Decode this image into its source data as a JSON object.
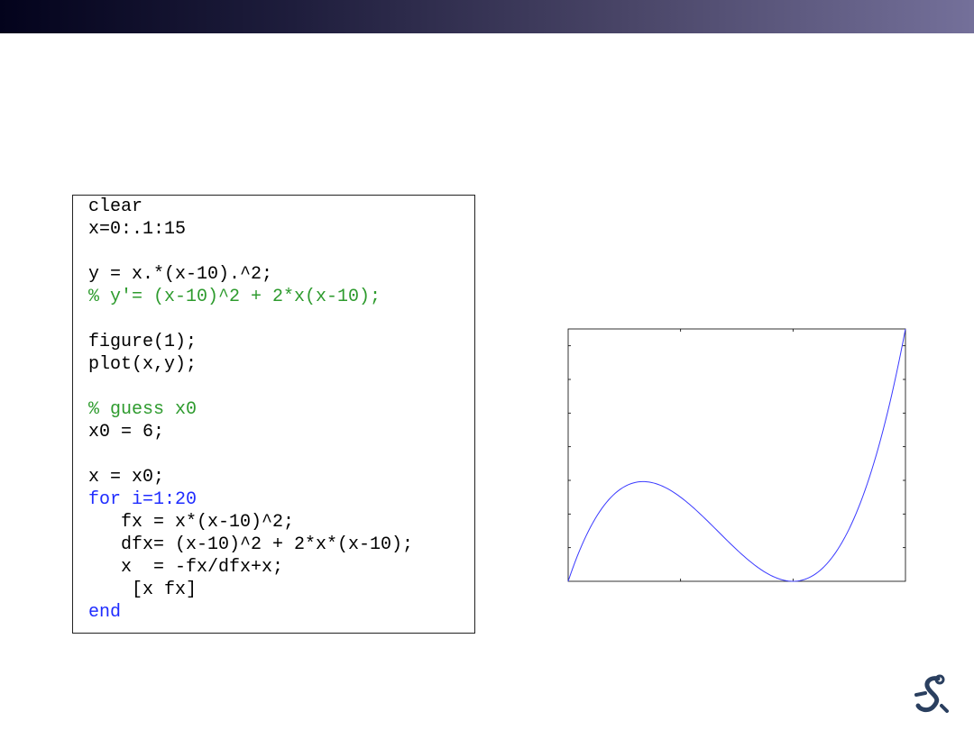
{
  "slide": {
    "title_bar_colors": [
      "#03031c",
      "#74709a"
    ]
  },
  "code": {
    "lines": [
      {
        "text": "clear",
        "kind": "plain"
      },
      {
        "text": "x=0:.1:15",
        "kind": "plain"
      },
      {
        "text": "",
        "kind": "plain"
      },
      {
        "text": "y = x.*(x-10).^2;",
        "kind": "plain"
      },
      {
        "text": "% y'= (x-10)^2 + 2*x(x-10);",
        "kind": "comment"
      },
      {
        "text": "",
        "kind": "plain"
      },
      {
        "text": "figure(1);",
        "kind": "plain"
      },
      {
        "text": "plot(x,y);",
        "kind": "plain"
      },
      {
        "text": "",
        "kind": "plain"
      },
      {
        "text": "% guess x0",
        "kind": "comment"
      },
      {
        "text": "x0 = 6;",
        "kind": "plain"
      },
      {
        "text": "",
        "kind": "plain"
      },
      {
        "text": "x = x0;",
        "kind": "plain"
      },
      {
        "text": "for i=1:20",
        "kind": "keyword"
      },
      {
        "text": "   fx = x*(x-10)^2;",
        "kind": "plain"
      },
      {
        "text": "   dfx= (x-10)^2 + 2*x*(x-10);",
        "kind": "plain"
      },
      {
        "text": "   x  = -fx/dfx+x;",
        "kind": "plain"
      },
      {
        "text": "    [x fx]",
        "kind": "plain"
      },
      {
        "text": "end",
        "kind": "keyword"
      }
    ],
    "colors": {
      "comment": "#2e9b2e",
      "keyword": "#1f2cff",
      "plain": "#000000"
    }
  },
  "chart_data": {
    "type": "line",
    "title": "",
    "xlabel": "",
    "ylabel": "",
    "function": "y = x.*(x-10).^2",
    "xlim": [
      0,
      15
    ],
    "ylim": [
      0,
      375
    ],
    "x_step": 0.1,
    "ticks_labeled": false,
    "grid": false,
    "series": [
      {
        "color": "#3a3aff"
      }
    ]
  },
  "logo": {
    "icon": "robot-arm-logo-icon",
    "color": "#2a3f5f"
  }
}
